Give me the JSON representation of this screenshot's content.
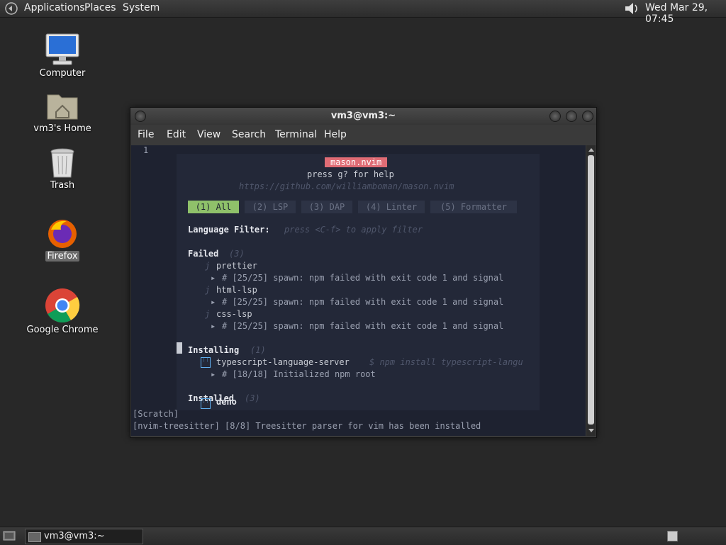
{
  "top_panel": {
    "menus": [
      "Applications",
      "Places",
      "System"
    ],
    "clock": "Wed Mar 29, 07:45"
  },
  "desktop_icons": [
    {
      "label": "Computer"
    },
    {
      "label": "vm3's Home"
    },
    {
      "label": "Trash"
    },
    {
      "label": "Firefox"
    },
    {
      "label": "Google Chrome"
    }
  ],
  "window": {
    "title": "vm3@vm3:~",
    "menu": [
      "File",
      "Edit",
      "View",
      "Search",
      "Terminal",
      "Help"
    ]
  },
  "terminal": {
    "line_number": "1",
    "mason": {
      "title": "mason.nvim",
      "help": "press g? for help",
      "url": "https://github.com/williamboman/mason.nvim",
      "tabs": [
        "(1) All",
        "(2) LSP",
        "(3) DAP",
        "(4) Linter",
        "(5) Formatter"
      ],
      "filter_label": "Language Filter:",
      "filter_hint": "press <C-f> to apply filter",
      "failed_heading": "Failed",
      "failed_count": "(3)",
      "failed": [
        {
          "name": "prettier",
          "msg": "# [25/25] spawn: npm failed with exit code 1 and signal"
        },
        {
          "name": "html-lsp",
          "msg": "# [25/25] spawn: npm failed with exit code 1 and signal"
        },
        {
          "name": "css-lsp",
          "msg": "# [25/25] spawn: npm failed with exit code 1 and signal"
        }
      ],
      "installing_heading": "Installing",
      "installing_count": "(1)",
      "installing_name": "typescript-language-server",
      "installing_cmd": "$ npm install typescript-langu",
      "installing_msg": "# [18/18] Initialized npm root",
      "installed_heading": "Installed",
      "installed_count": "(3)",
      "installed_name": "deno"
    },
    "scratch": "[Scratch]",
    "status": "[nvim-treesitter] [8/8] Treesitter parser for vim has been installed"
  },
  "taskbar": {
    "task_label": "vm3@vm3:~"
  }
}
